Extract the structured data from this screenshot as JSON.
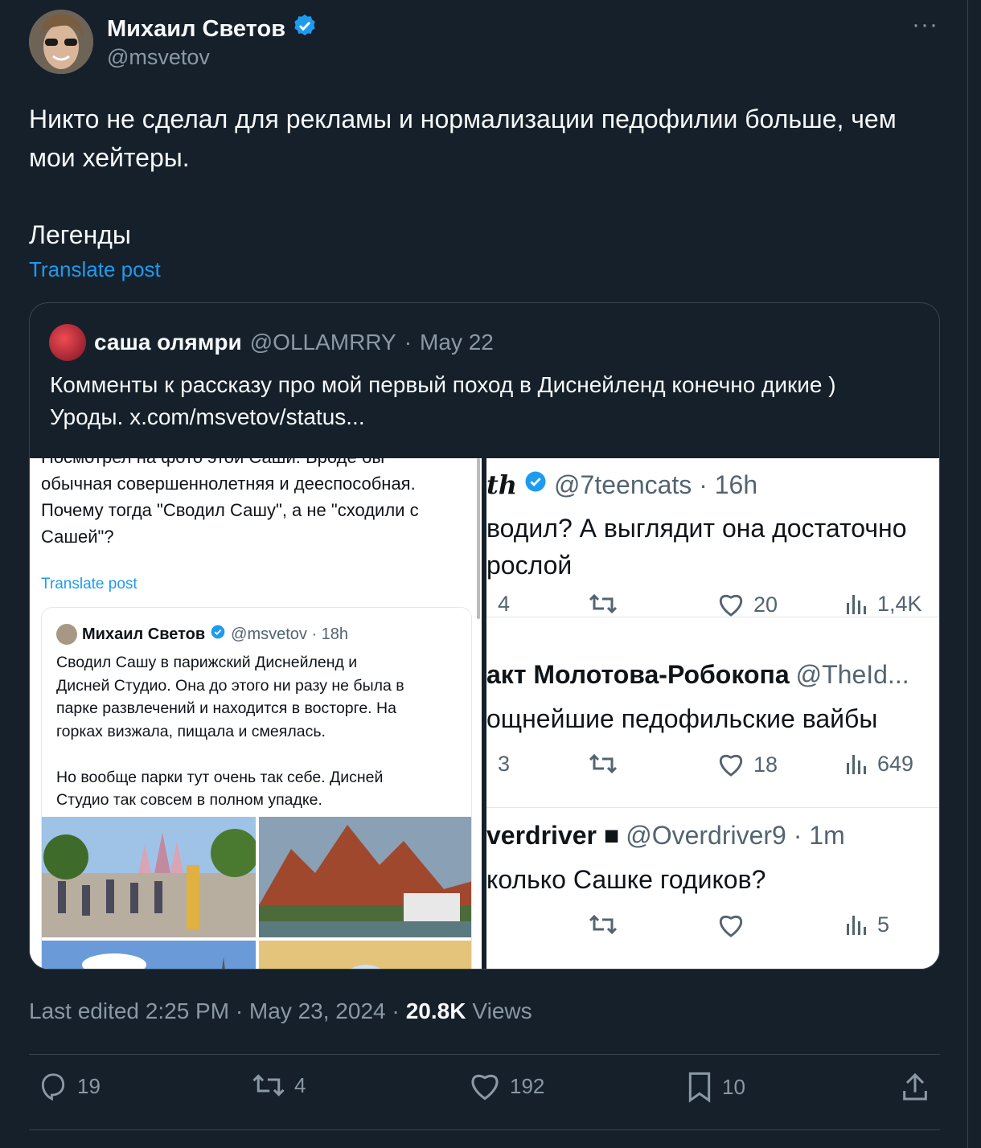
{
  "author": {
    "name": "Михаил Светов",
    "handle": "@msvetov"
  },
  "more_label": "···",
  "tweet": {
    "text": "Никто не сделал для рекламы и нормализации педофилии больше, чем\nмои хейтеры.\n\nЛегенды",
    "translate": "Translate post"
  },
  "quote": {
    "name": "саша олямри",
    "handle": "@OLLAMRRY",
    "date": "May 22",
    "text": "Комменты к рассказу про мой первый поход в Диснейленд конечно дикие )\nУроды.  x.com/msvetov/status...",
    "left_pane": {
      "top_text": "Посмотрел на фото этой Саши. Вроде бы\nобычная совершеннолетняя и дееспособная.\nПочему тогда \"Сводил Сашу\", а не \"сходили с\nСашей\"?",
      "translate": "Translate post",
      "inner": {
        "name": "Михаил Светов",
        "meta": "@msvetov · 18h",
        "text": "Сводил Сашу в парижский Диснейленд и\nДисней Студио. Она до этого ни разу не была в\nпарке развлечений и находится в восторге. На\nгорках визжала, пищала и смеялась.\n\nНо вообще парки тут очень так себе. Дисней\nСтудио так совсем в полном упадке."
      }
    },
    "right_pane": {
      "replies": [
        {
          "name": "th",
          "meta": "@7teencats · 16h",
          "text": "водил? А выглядит она достаточно\nрослой",
          "replies_count": "4",
          "likes": "20",
          "views": "1,4K"
        },
        {
          "name": "акт Молотова-Робокопа",
          "meta": "@TheId...",
          "text": "ощнейшие педофильские вайбы",
          "replies_count": "3",
          "likes": "18",
          "views": "649"
        },
        {
          "name": "verdriver ■",
          "meta": "@Overdriver9 · 1m",
          "text": "колько Сашке годиков?",
          "replies_count": "",
          "likes": "",
          "views": "5"
        }
      ]
    }
  },
  "footer": {
    "edited": "Last edited 2:25 PM · May 23, 2024 ·",
    "views_count": "20.8K",
    "views_label": "Views"
  },
  "actions": {
    "replies": "19",
    "reposts": "4",
    "likes": "192",
    "bookmarks": "10"
  },
  "colors": {
    "background": "#15202b",
    "accent": "#1d9bf0",
    "muted": "#8b98a5"
  }
}
